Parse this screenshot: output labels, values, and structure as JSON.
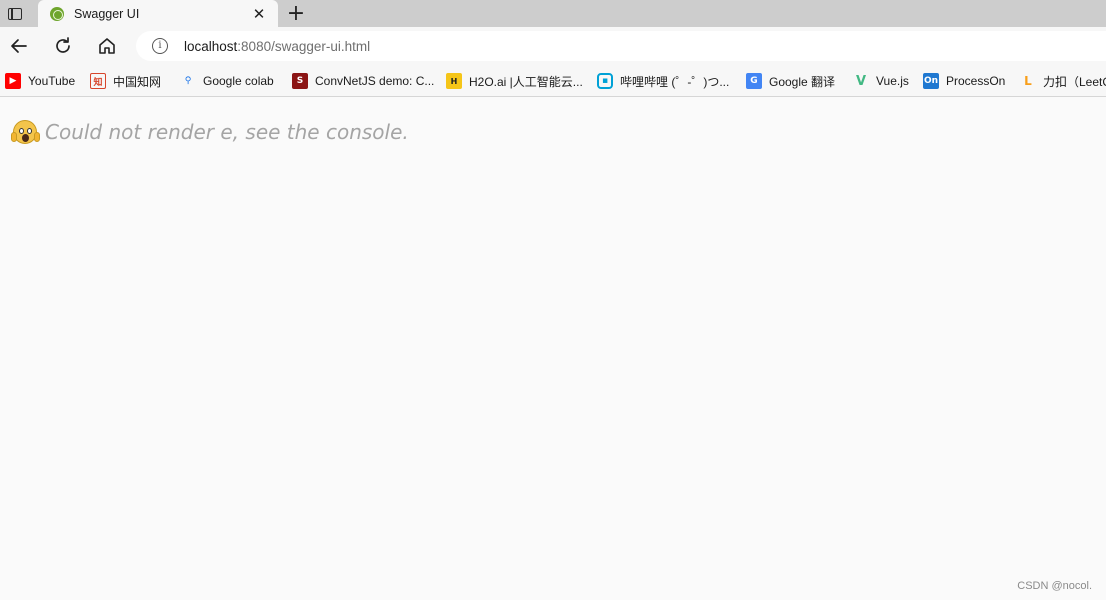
{
  "tab": {
    "title": "Swagger UI",
    "close_glyph": "✕"
  },
  "new_tab_glyph": "+",
  "address": {
    "host": "localhost",
    "rest": ":8080/swagger-ui.html",
    "info_glyph": "i"
  },
  "bookmarks": [
    {
      "label": "YouTube",
      "icon": "youtube-icon",
      "color": "#ff0000"
    },
    {
      "label": "中国知网",
      "icon": "cnki-icon",
      "color": "#d7452b"
    },
    {
      "label": "Google colab",
      "icon": "search-icon",
      "color": "#1a73e8"
    },
    {
      "label": "ConvNetJS demo: C...",
      "icon": "stanford-icon",
      "color": "#8c1515"
    },
    {
      "label": "H2O.ai |人工智能云...",
      "icon": "h2o-icon",
      "color": "#f5c518"
    },
    {
      "label": "哔哩哔哩 (゜-゜)つ...",
      "icon": "bilibili-icon",
      "color": "#00a1d6"
    },
    {
      "label": "Google 翻译",
      "icon": "google-translate-icon",
      "color": "#4285f4"
    },
    {
      "label": "Vue.js",
      "icon": "vue-icon",
      "color": "#42b883"
    },
    {
      "label": "ProcessOn",
      "icon": "processon-icon",
      "color": "#1f78d1"
    },
    {
      "label": "力扣（LeetC",
      "icon": "leetcode-icon",
      "color": "#f89f1b"
    }
  ],
  "error": {
    "message": "Could not render e, see the console."
  },
  "watermark": "CSDN @nocol."
}
